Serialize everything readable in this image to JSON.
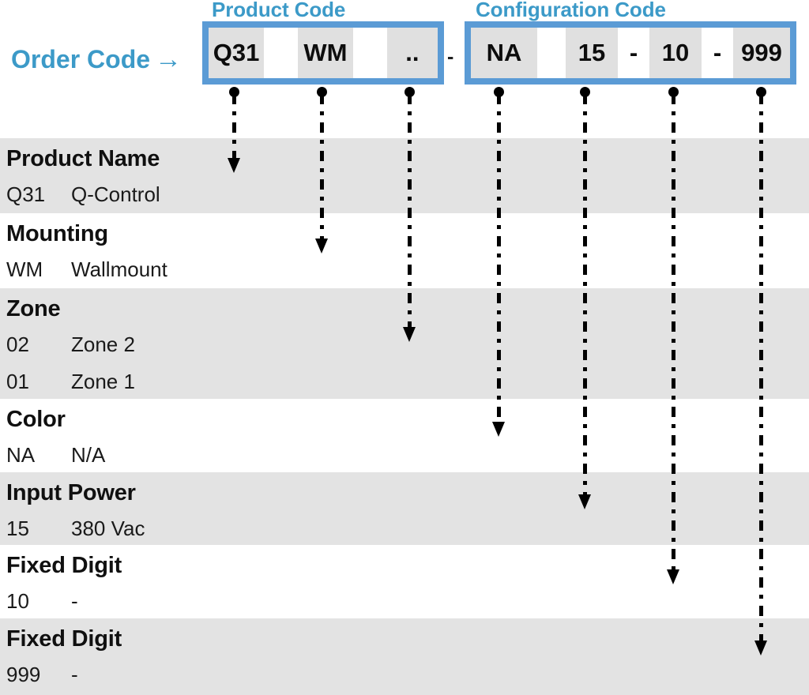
{
  "header": {
    "order_code_label": "Order Code",
    "order_code_arrow": "→",
    "product_code_title": "Product Code",
    "configuration_code_title": "Configuration Code",
    "box_separator": "-",
    "accent_color": "#3C9AC8",
    "box_border_color": "#5B9BD5",
    "cell_fill_color": "#E0E0E0",
    "band_gray_color": "#E3E3E3",
    "band_white_color": "#FFFFFF"
  },
  "product_code_cells": [
    {
      "text": "Q31",
      "style": "filled"
    },
    {
      "text": "",
      "style": "blank"
    },
    {
      "text": "WM",
      "style": "filled"
    },
    {
      "text": "",
      "style": "blank"
    },
    {
      "text": "..",
      "style": "filled"
    }
  ],
  "configuration_code_cells": [
    {
      "text": "NA",
      "style": "filled"
    },
    {
      "text": "",
      "style": "blank"
    },
    {
      "text": "15",
      "style": "filled"
    },
    {
      "text": "-",
      "style": "dash"
    },
    {
      "text": "10",
      "style": "filled"
    },
    {
      "text": "-",
      "style": "dash"
    },
    {
      "text": "999",
      "style": "filled"
    }
  ],
  "sections": [
    {
      "title": "Product Name",
      "band": "gray",
      "options": [
        {
          "code": "Q31",
          "desc": "Q-Control"
        }
      ]
    },
    {
      "title": "Mounting",
      "band": "white",
      "options": [
        {
          "code": "WM",
          "desc": "Wallmount"
        }
      ]
    },
    {
      "title": "Zone",
      "band": "gray",
      "options": [
        {
          "code": "02",
          "desc": "Zone 2"
        },
        {
          "code": "01",
          "desc": "Zone 1"
        }
      ]
    },
    {
      "title": "Color",
      "band": "white",
      "options": [
        {
          "code": "NA",
          "desc": "N/A"
        }
      ]
    },
    {
      "title": "Input Power",
      "band": "gray",
      "options": [
        {
          "code": "15",
          "desc": "380 Vac"
        }
      ]
    },
    {
      "title": "Fixed Digit",
      "band": "white",
      "options": [
        {
          "code": "10",
          "desc": "-"
        }
      ]
    },
    {
      "title": "Fixed Digit",
      "band": "gray",
      "options": [
        {
          "code": "999",
          "desc": "-"
        }
      ]
    }
  ],
  "connectors": [
    {
      "name": "connector-q31",
      "source_cell": "Q31",
      "target_section": "Product Name"
    },
    {
      "name": "connector-wm",
      "source_cell": "WM",
      "target_section": "Mounting"
    },
    {
      "name": "connector-zone",
      "source_cell": "..",
      "target_section": "Zone"
    },
    {
      "name": "connector-na",
      "source_cell": "NA",
      "target_section": "Color"
    },
    {
      "name": "connector-15",
      "source_cell": "15",
      "target_section": "Input Power"
    },
    {
      "name": "connector-10",
      "source_cell": "10",
      "target_section": "Fixed Digit"
    },
    {
      "name": "connector-999",
      "source_cell": "999",
      "target_section": "Fixed Digit"
    }
  ]
}
